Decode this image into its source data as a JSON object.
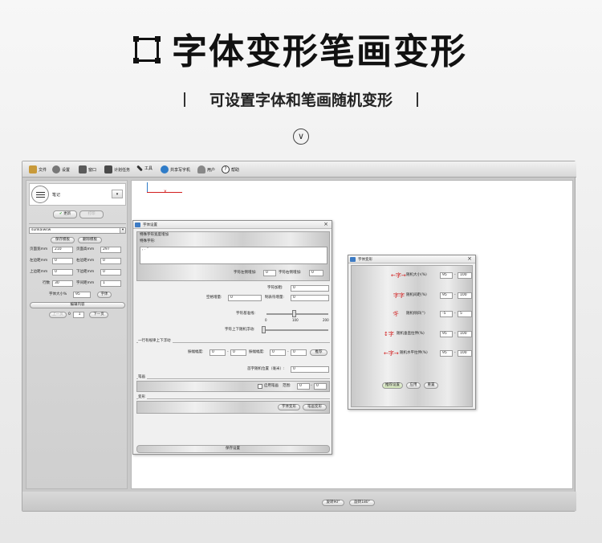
{
  "header": {
    "title": "字体变形笔画变形",
    "subtitle": "可设置字体和笔画随机变形"
  },
  "menu": [
    {
      "label": "文件",
      "icon": "folder-icon"
    },
    {
      "label": "设置",
      "icon": "gear-icon"
    },
    {
      "label": "窗口",
      "icon": "window-icon"
    },
    {
      "label": "计划任务",
      "icon": "task-icon"
    },
    {
      "label": "工具",
      "icon": "wrench-icon"
    },
    {
      "label": "共享写字机",
      "icon": "share-icon"
    },
    {
      "label": "用户",
      "icon": "user-icon"
    },
    {
      "label": "帮助",
      "icon": "help-icon"
    }
  ],
  "left_panel": {
    "doc_label": "笔记",
    "update_button": "更新",
    "disabled_button": "打印",
    "font_select": "sunkaiwsw",
    "save_template": "保存模板",
    "delete_template": "删除模板",
    "fields": [
      {
        "label1": "页面宽mm",
        "value1": "210",
        "label2": "页面高mm",
        "value2": "297"
      },
      {
        "label1": "左边距mm",
        "value1": "0",
        "label2": "右边距mm",
        "value2": "0"
      },
      {
        "label1": "上边距mm",
        "value1": "0",
        "label2": "下边距mm",
        "value2": "0"
      },
      {
        "label1": "行数",
        "value1": "30",
        "label2": "字间距mm",
        "value2": "1"
      }
    ],
    "font_size_label": "字体大小%",
    "font_size_value": "95",
    "font_button": "字体",
    "edit_content": "编辑内容",
    "prev_page": "上一页",
    "page_num": "1",
    "page_total": "0",
    "next_page": "下一页"
  },
  "font_dialog": {
    "title": "字体设置",
    "special_section": "特殊字符宽度增加",
    "special_label": "特殊字符:",
    "special_value": ", . \"",
    "left_inc_label": "字符左侧增加:",
    "left_inc_value": "0",
    "right_inc_label": "字符右侧增加:",
    "right_inc_value": "0",
    "thicken_label": "字符加粗:",
    "thicken_value": "0",
    "space_label": "空格增量:",
    "space_value": "0",
    "indent_label": "制表符增量:",
    "indent_value": "0",
    "baseline_label": "字符基准线:",
    "slider_min": "0",
    "slider_mid": "100",
    "slider_max": "200",
    "float_label": "字符上下随机浮动:",
    "line_float_section": "一行有规律上下浮动",
    "rise_label": "振幅幅度:",
    "rise_from": "0",
    "rise_to": "0",
    "width_label": "振幅幅度:",
    "width_from": "0",
    "width_to": "0",
    "apply_button": "推荐",
    "random_pos_label": "首字随机位置（毫米）:",
    "random_pos_value": "0",
    "stroke_section": "笔画",
    "stroke_check": "启用笔画",
    "stroke_range": "范围:",
    "stroke_from": "0",
    "stroke_to": "0",
    "deform_section": "变形",
    "font_deform_button": "字体变形",
    "stroke_deform_button": "笔画变形",
    "save_button": "保存设置"
  },
  "deform_dialog": {
    "title": "字体变形",
    "rows": [
      {
        "label": "随机大小(%)",
        "from": "95",
        "to": "100"
      },
      {
        "label": "随机间距(%)",
        "from": "95",
        "to": "100"
      },
      {
        "label": "随机倾斜(°)",
        "from": "-5",
        "to": "5"
      },
      {
        "label": "随机垂直拉伸(%)",
        "from": "95",
        "to": "100"
      },
      {
        "label": "随机水平拉伸(%)",
        "from": "95",
        "to": "100"
      }
    ],
    "recommend_button": "推荐设置",
    "apply_button": "应用",
    "reset_button": "重置"
  },
  "status": {
    "rotate90": "旋转90°",
    "rotate180": "旋转180°"
  },
  "colors": {
    "accent_blue": "#3d7bc4",
    "axis_red": "#d21f1f"
  }
}
